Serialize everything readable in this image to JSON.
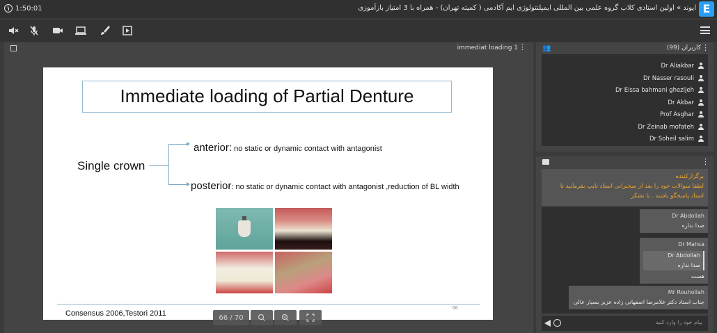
{
  "titlebar": {
    "timer": "1:50:01",
    "title": "ایوند » اولین استادی کلاب گروه علمی بین المللی ایمپلنتولوژی ایم آکادمی ( کمیته تهران) - همراه با 3 امتیاز بازآموزی",
    "logo": "E"
  },
  "toolbar": {
    "icons": [
      "speaker-off-icon",
      "mic-off-icon",
      "camera-icon",
      "screen-icon",
      "brush-icon",
      "play-icon",
      "menu-icon"
    ]
  },
  "presentation": {
    "name": "immediat loading 1",
    "slide": {
      "title": "Immediate loading of Partial Denture",
      "single_crown": "Single crown",
      "anterior_label": "anterior:",
      "anterior_text": " no static or dynamic contact with antagonist",
      "posterior_label": "posterior",
      "posterior_text": ": no static or dynamic contact with antagonist ,reduction of BL width",
      "footer": "Consensus 2006,Testori 2011",
      "page_number": "66"
    },
    "nav": {
      "page": "66 / 70"
    }
  },
  "users": {
    "title": "کاربران (99)",
    "items": [
      "Dr Aliakbar",
      "Dr Nasser rasouli",
      "Dr Eissa bahmani ghezljeh",
      "Dr Akbar",
      "Prof Asghar",
      "Dr Zeinab mofateh",
      "Dr Soheil salim"
    ]
  },
  "chat": {
    "moderator_name": "برگزارکننده",
    "moderator_text": "لطفا سوالات خود را بعد از سخنرانی استاد تایپ بفرمایید تا استاد پاسخگو باشند . با تشکر",
    "messages": [
      {
        "author": "Dr Abdollah",
        "text": "صدا نداره"
      },
      {
        "author": "Dr Mahsa",
        "quote_author": "Dr Abdollah",
        "quote_text": "صدا نداره",
        "text": "هست"
      },
      {
        "author": "Mr Rouhollah",
        "text": "جناب استاد دکتر غلامرضا اصفهانی زاده عزیز بسیار عالی"
      }
    ],
    "input_placeholder": "پیام خود را وارد کنید"
  }
}
